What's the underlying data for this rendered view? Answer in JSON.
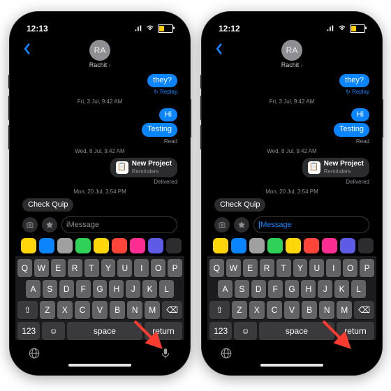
{
  "phones": [
    {
      "time": "12:13",
      "show_mic": true,
      "placeholder": "iMessage",
      "active": false
    },
    {
      "time": "12:12",
      "show_mic": false,
      "placeholder": "Message",
      "active": true
    }
  ],
  "contact": {
    "initials": "RA",
    "name": "Rachit"
  },
  "thread": {
    "reply_bubble": "they?",
    "replay": "↻ Replay",
    "ts1": "Fri, 3 Jul, 9:42 AM",
    "hi": "Hi",
    "testing": "Testing",
    "read1": "Read",
    "ts2": "Wed, 8 Jul, 9:42 AM",
    "rich_title": "New Project",
    "rich_sub": "Reminders",
    "delivered": "Delivered",
    "ts3": "Mon, 20 Jul, 3:54 PM",
    "incoming": "Check Quip"
  },
  "apps_colors": [
    "#ffd60a",
    "#0a84ff",
    "#a0a0a0",
    "#30d158",
    "#ffd60a",
    "#ff453a",
    "#ff2d92",
    "#5e5ce6",
    "#2c2c2e"
  ],
  "keyboard": {
    "r1": [
      "Q",
      "W",
      "E",
      "R",
      "T",
      "Y",
      "U",
      "I",
      "O",
      "P"
    ],
    "r2": [
      "A",
      "S",
      "D",
      "F",
      "G",
      "H",
      "J",
      "K",
      "L"
    ],
    "r3": [
      "Z",
      "X",
      "C",
      "V",
      "B",
      "N",
      "M"
    ],
    "shift": "⇧",
    "del": "⌫",
    "num": "123",
    "emoji": "☺",
    "space": "space",
    "ret": "return",
    "globe": "globe",
    "mic": "mic"
  },
  "input_icons": {
    "camera": "camera",
    "apps": "apps",
    "expand": "expand"
  }
}
